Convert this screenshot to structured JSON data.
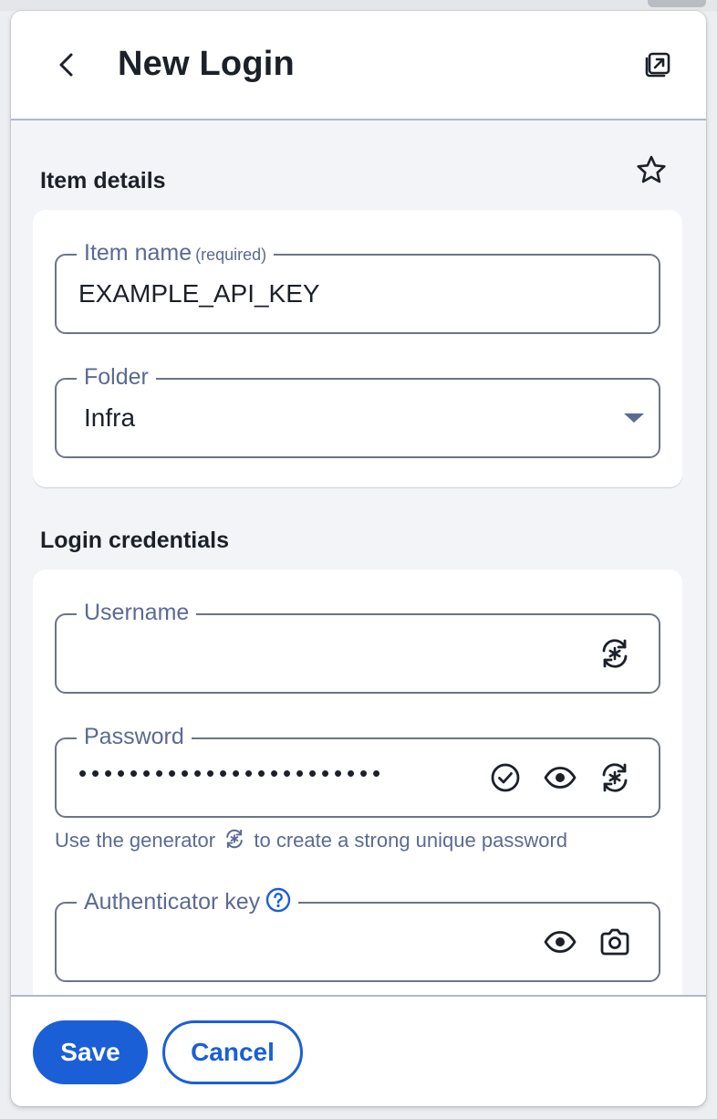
{
  "header": {
    "title": "New Login",
    "back_icon": "chevron-left-icon",
    "popout_icon": "popout-window-icon"
  },
  "item_details": {
    "section_title": "Item details",
    "favorite_icon": "star-outline-icon",
    "item_name": {
      "label": "Item name",
      "required_hint": "(required)",
      "value": "EXAMPLE_API_KEY"
    },
    "folder": {
      "label": "Folder",
      "selected": "Infra"
    }
  },
  "login_credentials": {
    "section_title": "Login credentials",
    "username": {
      "label": "Username",
      "value": "",
      "generate_icon": "generate-icon"
    },
    "password": {
      "label": "Password",
      "masked_value": "••••••••••••••••••••••••",
      "check_icon": "check-circle-icon",
      "toggle_visibility_icon": "eye-icon",
      "generate_icon": "generate-icon",
      "helper_prefix": "Use the generator",
      "helper_suffix": "to create a strong unique password"
    },
    "authenticator_key": {
      "label": "Authenticator key",
      "help_icon": "question-circle-icon",
      "toggle_visibility_icon": "eye-icon",
      "scan_icon": "camera-icon"
    }
  },
  "footer": {
    "save_label": "Save",
    "cancel_label": "Cancel"
  },
  "colors": {
    "primary": "#1a5fd6",
    "label": "#5b6a92",
    "text": "#1b2029",
    "background": "#f3f4f8"
  }
}
